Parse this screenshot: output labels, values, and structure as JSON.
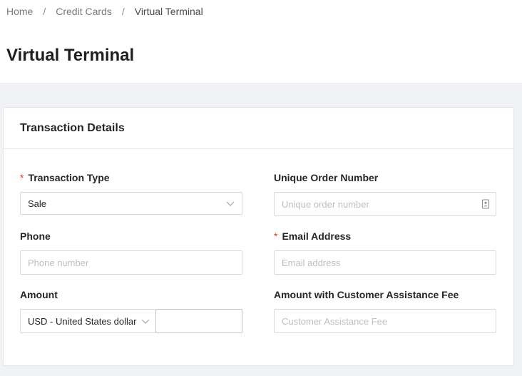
{
  "breadcrumb": {
    "items": [
      "Home",
      "Credit Cards",
      "Virtual Terminal"
    ],
    "separator": "/"
  },
  "page": {
    "title": "Virtual Terminal"
  },
  "card": {
    "title": "Transaction Details"
  },
  "form": {
    "transaction_type": {
      "label": "Transaction Type",
      "value": "Sale",
      "required_mark": "*"
    },
    "order_number": {
      "label": "Unique Order Number",
      "placeholder": "Unique order number"
    },
    "phone": {
      "label": "Phone",
      "placeholder": "Phone number"
    },
    "email": {
      "label": "Email Address",
      "placeholder": "Email address",
      "required_mark": "*"
    },
    "amount": {
      "label": "Amount",
      "currency_value": "USD - United States dollar",
      "amount_value": ""
    },
    "assistance_fee": {
      "label": "Amount with Customer Assistance Fee",
      "placeholder": "Customer Assistance Fee"
    }
  },
  "colors": {
    "required": "#e53935",
    "page_background": "#f0f2f5",
    "border": "#d9d9d9"
  },
  "icons": {
    "select_arrow": "chevron-down-icon",
    "order_number_suffix": "contact-card-icon"
  }
}
